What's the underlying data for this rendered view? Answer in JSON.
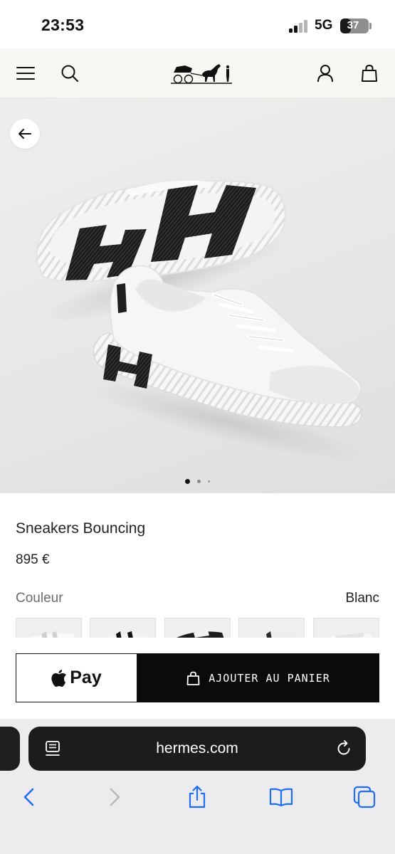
{
  "status_bar": {
    "time": "23:53",
    "network": "5G",
    "battery": "37",
    "battery_level_percent": 37
  },
  "site_header": {
    "logo_name": "hermes-caleche-logo",
    "icons": [
      "menu-icon",
      "search-icon",
      "account-icon",
      "shopping-bag-icon"
    ]
  },
  "gallery": {
    "slide_count": 3,
    "active_slide": 1,
    "back_icon": "arrow-left-icon"
  },
  "product": {
    "name": "Sneakers Bouncing",
    "price": "895 €",
    "color_label": "Couleur",
    "color_value": "Blanc",
    "swatch_count": 5
  },
  "actions": {
    "apple_pay_label": "Pay",
    "add_to_cart_label": "AJOUTER AU PANIER"
  },
  "browser": {
    "url": "hermes.com",
    "toolbar_icons": [
      "back-icon",
      "forward-icon",
      "share-icon",
      "bookmarks-icon",
      "tabs-icon"
    ]
  },
  "colors": {
    "header_bg": "#f8f7f3",
    "button_black": "#0b0b0b",
    "gallery_bg": "#e9e9e8",
    "url_bar": "#1c1c1e"
  }
}
